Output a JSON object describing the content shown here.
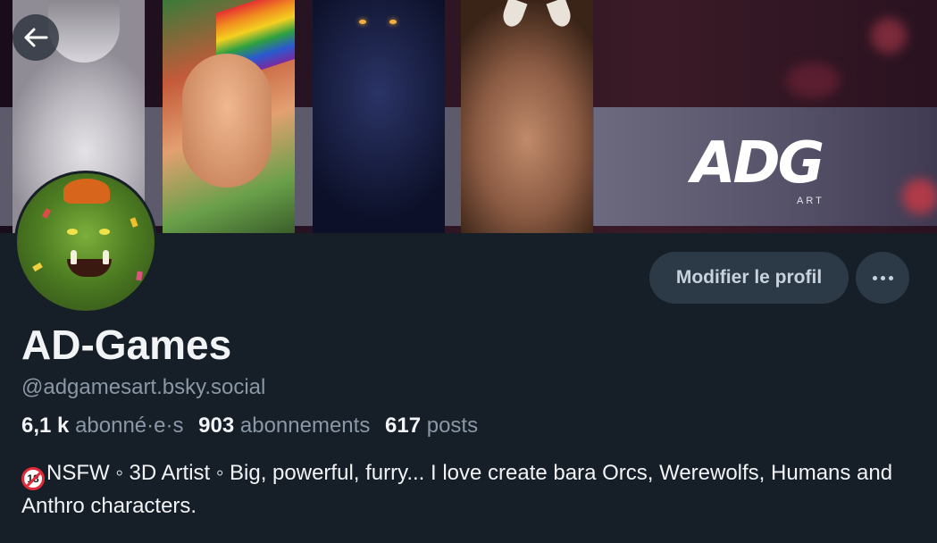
{
  "banner": {
    "logo_text": "ADG",
    "logo_subtext": "ART"
  },
  "profile": {
    "display_name": "AD-Games",
    "handle": "@adgamesart.bsky.social",
    "stats": {
      "followers_count": "6,1 k",
      "followers_label": "abonné·e·s",
      "following_count": "903",
      "following_label": "abonnements",
      "posts_count": "617",
      "posts_label": "posts"
    },
    "bio_badge": "18",
    "bio": "NSFW ◦ 3D Artist ◦ Big, powerful, furry... I love create bara Orcs, Werewolfs, Humans and Anthro characters."
  },
  "actions": {
    "edit_profile_label": "Modifier le profil",
    "more_icon": "more-horizontal-icon"
  },
  "navigation": {
    "back_icon": "arrow-left-icon"
  },
  "colors": {
    "background": "#161e27",
    "button_bg": "#2c3a48",
    "muted_text": "#8a97a6",
    "primary_text": "#f1f3f5"
  }
}
